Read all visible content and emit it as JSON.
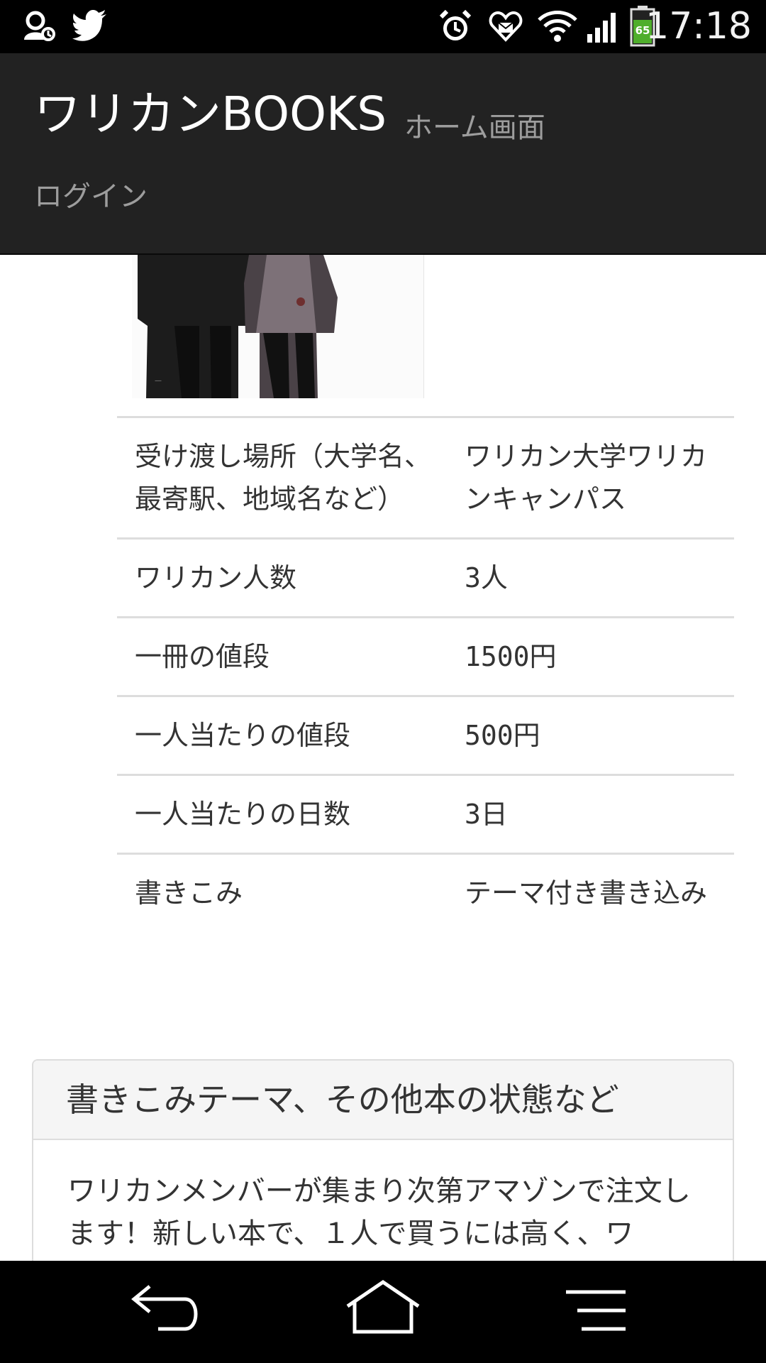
{
  "status_bar": {
    "time": "17:18",
    "battery": "65",
    "left_icons": [
      "contacts-sync-icon",
      "twitter-icon"
    ],
    "right_icons": [
      "alarm-icon",
      "heart-notification-icon",
      "wifi-icon",
      "signal-icon",
      "battery-icon"
    ]
  },
  "header": {
    "brand": "ワリカンBOOKS",
    "subtitle": "ホーム画面",
    "login": "ログイン"
  },
  "details": {
    "rows": [
      {
        "label": "受け渡し場所（大学名、最寄駅、地域名など）",
        "value": "ワリカン大学ワリカンキャンパス"
      },
      {
        "label": "ワリカン人数",
        "value": "3人"
      },
      {
        "label": "一冊の値段",
        "value": "1500円"
      },
      {
        "label": "一人当たりの値段",
        "value": "500円"
      },
      {
        "label": "一人当たりの日数",
        "value": "3日"
      },
      {
        "label": "書きこみ",
        "value": "テーマ付き書き込み"
      }
    ]
  },
  "panel": {
    "heading": "書きこみテーマ、その他本の状態など",
    "body": "ワリカンメンバーが集まり次第アマゾンで注文します！新しい本で、１人で買うには高く、ワ"
  },
  "colors": {
    "navbar_bg": "#222222",
    "navbar_text": "#9d9d9d",
    "border": "#dddddd",
    "panel_heading_bg": "#f5f5f5"
  }
}
